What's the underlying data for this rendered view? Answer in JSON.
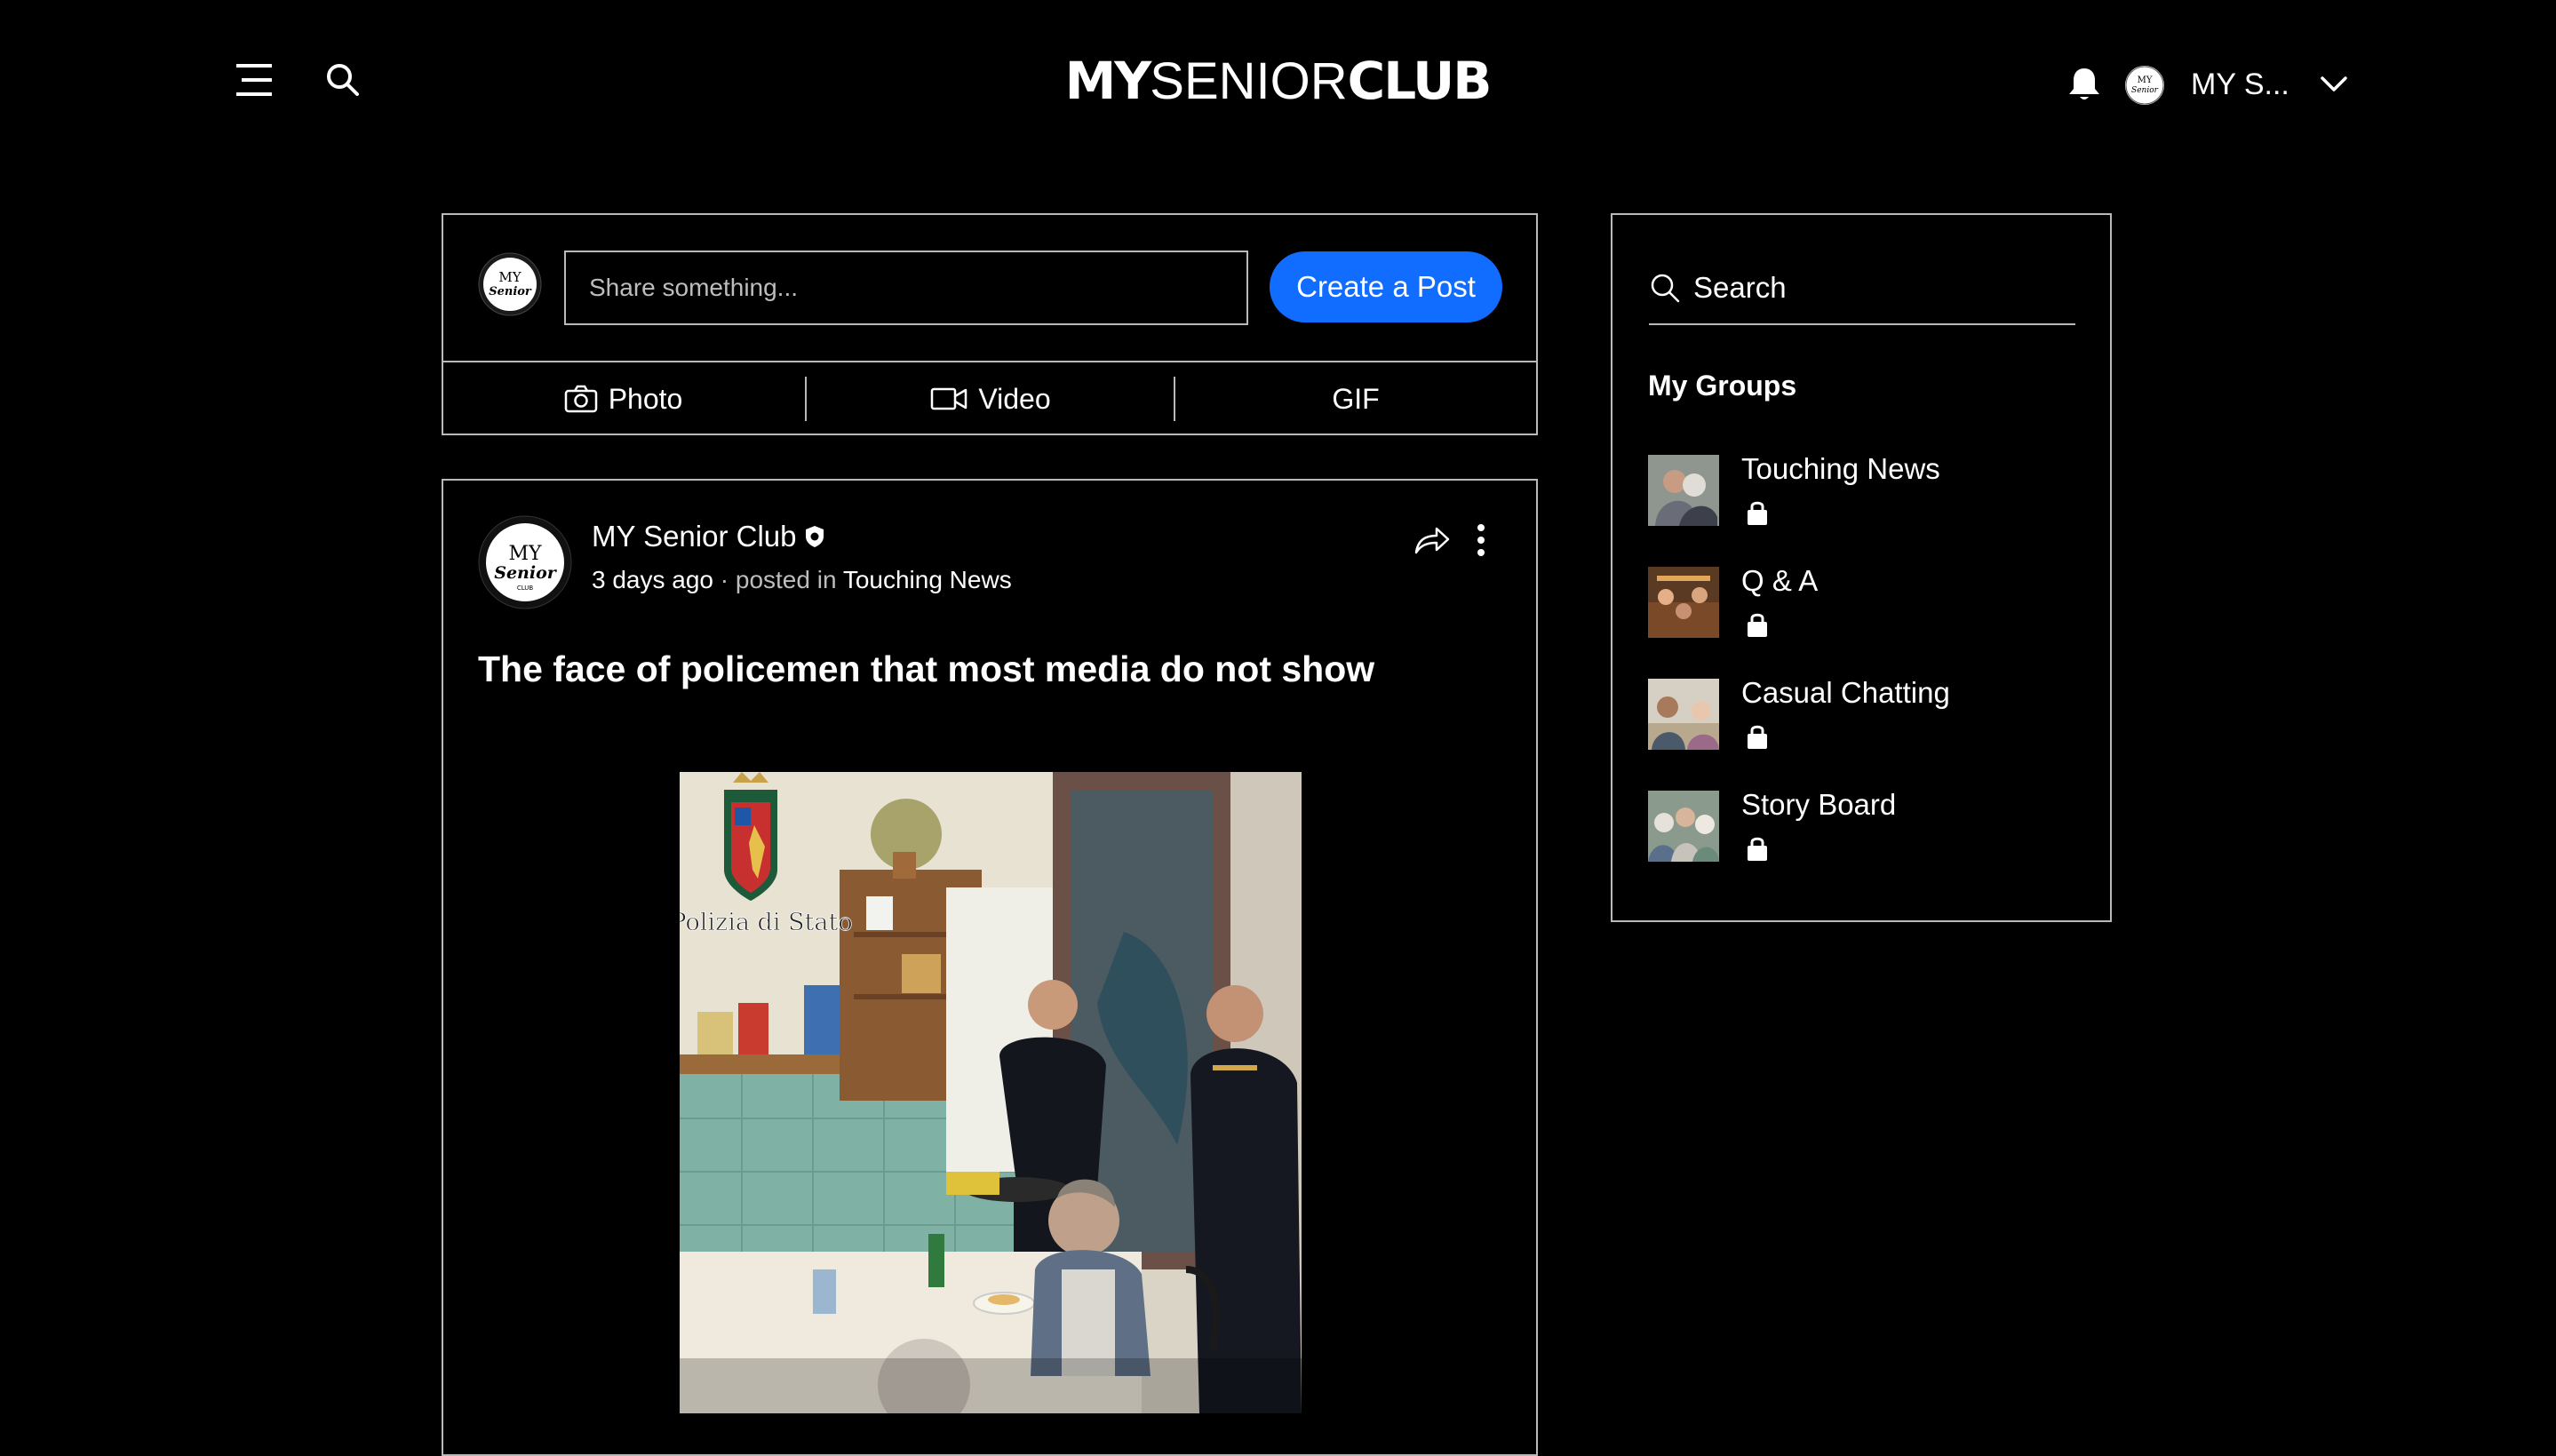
{
  "header": {
    "logo_my": "MY",
    "logo_senior": "SENIOR",
    "logo_club": "CLUB",
    "user_name": "MY S...",
    "avatar_text": "MY Senior"
  },
  "composer": {
    "avatar_text": "MY Senior Club",
    "placeholder": "Share something...",
    "create_label": "Create a Post",
    "photo_label": "Photo",
    "video_label": "Video",
    "gif_label": "GIF"
  },
  "post": {
    "author": "MY Senior Club",
    "time": "3 days ago",
    "posted_in": "· posted in",
    "group": "Touching News",
    "title": "The face of policemen that most media do not show",
    "photo_caption": "Polizia di Stato"
  },
  "sidebar": {
    "search_label": "Search",
    "groups_title": "My Groups",
    "groups": [
      {
        "name": "Touching News"
      },
      {
        "name": "Q & A"
      },
      {
        "name": "Casual Chatting"
      },
      {
        "name": "Story Board"
      }
    ]
  },
  "colors": {
    "background": "#000000",
    "accent": "#116dff",
    "border": "#b9b9b9",
    "muted_text": "#bdbdbd"
  },
  "icons": [
    "hamburger-icon",
    "search-icon",
    "bell-icon",
    "chevron-down-icon",
    "camera-icon",
    "video-icon",
    "share-icon",
    "more-vertical-icon",
    "verified-badge-icon",
    "lock-icon"
  ]
}
